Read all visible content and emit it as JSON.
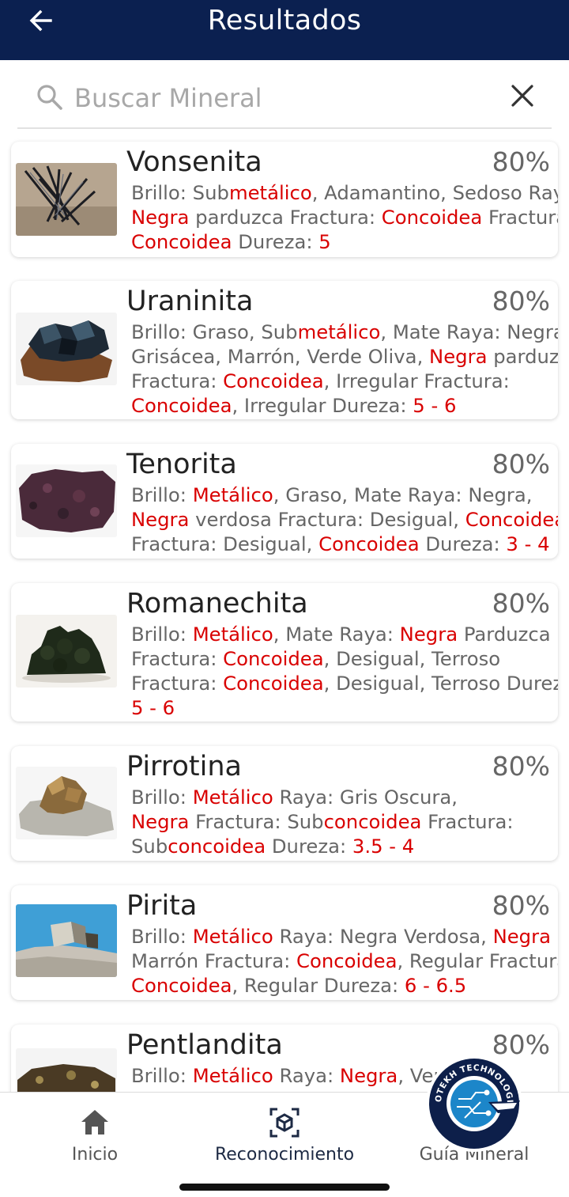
{
  "header": {
    "title": "Resultados",
    "back_icon": "arrow-left-icon"
  },
  "search": {
    "placeholder": "Buscar Mineral",
    "value": "",
    "search_icon": "magnifier-icon",
    "clear_icon": "close-icon"
  },
  "colors": {
    "header_bg": "#0b2050",
    "highlight": "#d90000",
    "text_gray": "#666666"
  },
  "results": [
    {
      "name": "Vonsenita",
      "percent": "80%",
      "lines": [
        [
          {
            "t": "Brillo: Sub"
          },
          {
            "t": "metálico",
            "h": true
          },
          {
            "t": ", Adamantino, Sedoso Raya:"
          }
        ],
        [
          {
            "t": "Negra",
            "h": true
          },
          {
            "t": " parduzca Fractura: "
          },
          {
            "t": "Concoidea",
            "h": true
          },
          {
            "t": " Fractura:"
          }
        ],
        [
          {
            "t": "Concoidea",
            "h": true
          },
          {
            "t": " Dureza: "
          },
          {
            "t": "5",
            "h": true
          }
        ]
      ]
    },
    {
      "name": "Uraninita",
      "percent": "80%",
      "lines": [
        [
          {
            "t": "Brillo: Graso, Sub"
          },
          {
            "t": "metálico",
            "h": true
          },
          {
            "t": ", Mate Raya: Negra"
          }
        ],
        [
          {
            "t": "Grisácea, Marrón, Verde Oliva, "
          },
          {
            "t": "Negra",
            "h": true
          },
          {
            "t": " parduzca"
          }
        ],
        [
          {
            "t": "Fractura: "
          },
          {
            "t": "Concoidea",
            "h": true
          },
          {
            "t": ", Irregular Fractura:"
          }
        ],
        [
          {
            "t": "Concoidea",
            "h": true
          },
          {
            "t": ", Irregular Dureza: "
          },
          {
            "t": "5 - 6",
            "h": true
          }
        ]
      ]
    },
    {
      "name": "Tenorita",
      "percent": "80%",
      "lines": [
        [
          {
            "t": "Brillo: "
          },
          {
            "t": "Metálico",
            "h": true
          },
          {
            "t": ", Graso, Mate Raya: Negra,"
          }
        ],
        [
          {
            "t": "Negra",
            "h": true
          },
          {
            "t": " verdosa Fractura: Desigual, "
          },
          {
            "t": "Concoidea",
            "h": true
          }
        ],
        [
          {
            "t": "Fractura: Desigual, "
          },
          {
            "t": "Concoidea",
            "h": true
          },
          {
            "t": " Dureza: "
          },
          {
            "t": "3 - 4",
            "h": true
          }
        ]
      ]
    },
    {
      "name": "Romanechita",
      "percent": "80%",
      "lines": [
        [
          {
            "t": "Brillo: "
          },
          {
            "t": "Metálico",
            "h": true
          },
          {
            "t": ", Mate Raya: "
          },
          {
            "t": "Negra",
            "h": true
          },
          {
            "t": " Parduzca"
          }
        ],
        [
          {
            "t": "Fractura: "
          },
          {
            "t": "Concoidea",
            "h": true
          },
          {
            "t": ", Desigual, Terroso"
          }
        ],
        [
          {
            "t": "Fractura: "
          },
          {
            "t": "Concoidea",
            "h": true
          },
          {
            "t": ", Desigual, Terroso Dureza:"
          }
        ],
        [
          {
            "t": "5 - 6",
            "h": true
          }
        ]
      ]
    },
    {
      "name": "Pirrotina",
      "percent": "80%",
      "lines": [
        [
          {
            "t": "Brillo: "
          },
          {
            "t": "Metálico",
            "h": true
          },
          {
            "t": " Raya: Gris Oscura,"
          }
        ],
        [
          {
            "t": "Negra",
            "h": true
          },
          {
            "t": " Fractura: Sub"
          },
          {
            "t": "concoidea",
            "h": true
          },
          {
            "t": " Fractura:"
          }
        ],
        [
          {
            "t": "Sub"
          },
          {
            "t": "concoidea",
            "h": true
          },
          {
            "t": " Dureza: "
          },
          {
            "t": "3.5 - 4",
            "h": true
          }
        ]
      ]
    },
    {
      "name": "Pirita",
      "percent": "80%",
      "lines": [
        [
          {
            "t": "Brillo: "
          },
          {
            "t": "Metálico",
            "h": true
          },
          {
            "t": " Raya: Negra Verdosa, "
          },
          {
            "t": "Negra",
            "h": true
          }
        ],
        [
          {
            "t": "Marrón Fractura: "
          },
          {
            "t": "Concoidea",
            "h": true
          },
          {
            "t": ", Regular Fractura:"
          }
        ],
        [
          {
            "t": "Concoidea",
            "h": true
          },
          {
            "t": ", Regular Dureza: "
          },
          {
            "t": "6 - 6.5",
            "h": true
          }
        ]
      ]
    },
    {
      "name": "Pentlandita",
      "percent": "80%",
      "lines": [
        [
          {
            "t": "Brillo: "
          },
          {
            "t": "Metálico",
            "h": true
          },
          {
            "t": " Raya: "
          },
          {
            "t": "Negra",
            "h": true
          },
          {
            "t": ", Verd"
          }
        ]
      ]
    }
  ],
  "nav": {
    "items": [
      {
        "label": "Inicio",
        "icon": "home-icon"
      },
      {
        "label": "Reconocimiento",
        "icon": "cube-scan-icon",
        "active": true
      },
      {
        "label": "Guía Mineral",
        "icon": "book-icon"
      }
    ]
  },
  "watermark": {
    "text": "GEOTEKH TECHNOLOGIES"
  }
}
